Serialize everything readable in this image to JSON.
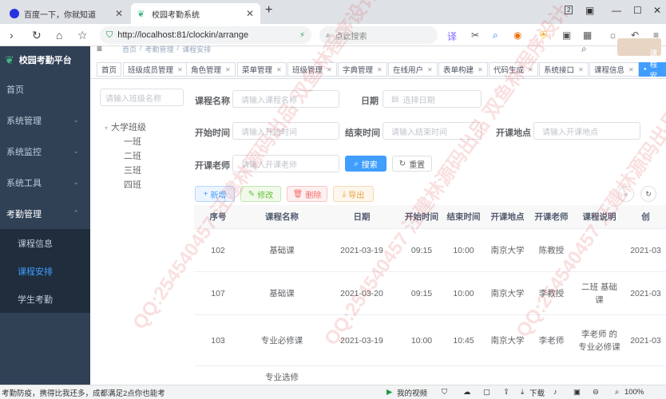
{
  "browser": {
    "tabs": [
      {
        "label": "百度一下，你就知道",
        "active": false
      },
      {
        "label": "校园考勤系统",
        "active": true
      }
    ],
    "new_tab": "+",
    "tab_counter": "2",
    "url": "http://localhost:81/clockin/arrange",
    "search_placeholder": "点此搜索"
  },
  "sidebar": {
    "title": "校园考勤平台",
    "items": [
      {
        "label": "首页"
      },
      {
        "label": "系统管理"
      },
      {
        "label": "系统监控"
      },
      {
        "label": "系统工具"
      },
      {
        "label": "考勤管理"
      }
    ],
    "sub_items": [
      {
        "label": "课程信息",
        "active": false
      },
      {
        "label": "课程安排",
        "active": true
      },
      {
        "label": "学生考勤",
        "active": false
      }
    ]
  },
  "breadcrumb": [
    "首页",
    "考勤管理",
    "课程安排"
  ],
  "tags": [
    "首页",
    "班级成员管理",
    "角色管理",
    "菜单管理",
    "班级管理",
    "字典管理",
    "在线用户",
    "表单构建",
    "代码生成",
    "系统接口",
    "课程信息",
    "课程安排"
  ],
  "tree": {
    "filter_placeholder": "请输入班级名称",
    "root": "大学班级",
    "children": [
      "一班",
      "二班",
      "三班",
      "四班"
    ]
  },
  "search_form": {
    "course_name_label": "课程名称",
    "course_name_placeholder": "请输入课程名称",
    "date_label": "日期",
    "date_placeholder": "选择日期",
    "start_label": "开始时间",
    "start_placeholder": "请输入开始时间",
    "end_label": "结束时间",
    "end_placeholder": "请输入结束时间",
    "place_label": "开课地点",
    "place_placeholder": "请输入开课地点",
    "teacher_label": "开课老师",
    "teacher_placeholder": "请输入开课老师",
    "search_btn": "搜索",
    "reset_btn": "重置"
  },
  "toolbar": {
    "add": "新增",
    "edit": "修改",
    "delete": "删除",
    "export": "导出"
  },
  "table": {
    "headers": [
      "序号",
      "课程名称",
      "日期",
      "开始时间",
      "结束时间",
      "开课地点",
      "开课老师",
      "课程说明",
      "创"
    ],
    "rows": [
      {
        "id": "102",
        "name": "基础课",
        "date": "2021-03-19",
        "start": "09:15",
        "end": "10:00",
        "place": "南京大学",
        "teacher": "陈教授",
        "desc": "",
        "created": "2021-03"
      },
      {
        "id": "107",
        "name": "基础课",
        "date": "2021-03-20",
        "start": "09:15",
        "end": "10:00",
        "place": "南京大学",
        "teacher": "李教授",
        "desc": "二班 基础课",
        "created": "2021-03"
      },
      {
        "id": "103",
        "name": "专业必修课",
        "date": "2021-03-19",
        "start": "10:00",
        "end": "10:45",
        "place": "南京大学",
        "teacher": "李老师",
        "desc": "李老师 的专业必修课",
        "created": "2021-03"
      },
      {
        "id": "",
        "name": "专业选修",
        "date": "",
        "start": "",
        "end": "",
        "place": "",
        "teacher": "",
        "desc": "",
        "created": ""
      }
    ]
  },
  "statusbar": {
    "left": "考勤防疫，携得比我还多，成都满足2点你也能考",
    "video": "我的视频",
    "download": "下载",
    "zoom": "100%"
  },
  "watermark": "QQ:254540457 汪建林源码出品 双鱼林程序设计",
  "colors": {
    "sidebar_bg": "#304156",
    "primary": "#409eff",
    "active_menu": "#409eff"
  }
}
